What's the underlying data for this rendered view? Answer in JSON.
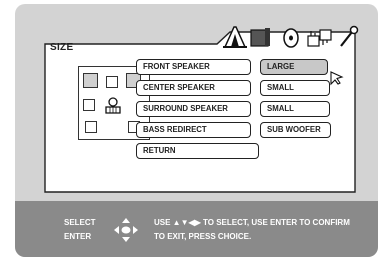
{
  "menu": {
    "title": "SIZE",
    "tab_icons": [
      "speaker-settings-icon",
      "monitor-icon",
      "disc-icon",
      "connection-icon",
      "wrench-icon"
    ]
  },
  "settings": [
    {
      "label": "FRONT SPEAKER",
      "value": "LARGE",
      "selected": true
    },
    {
      "label": "CENTER SPEAKER",
      "value": "SMALL",
      "selected": false
    },
    {
      "label": "SURROUND SPEAKER",
      "value": "SMALL",
      "selected": false
    },
    {
      "label": "BASS REDIRECT",
      "value": "SUB WOOFER",
      "selected": false
    }
  ],
  "return_label": "RETURN",
  "help": {
    "select_label": "SELECT",
    "enter_label": "ENTER",
    "line1": "USE ▲▼◀▶ TO SELECT, USE ENTER TO CONFIRM",
    "line2": "TO EXIT, PRESS CHOICE."
  }
}
